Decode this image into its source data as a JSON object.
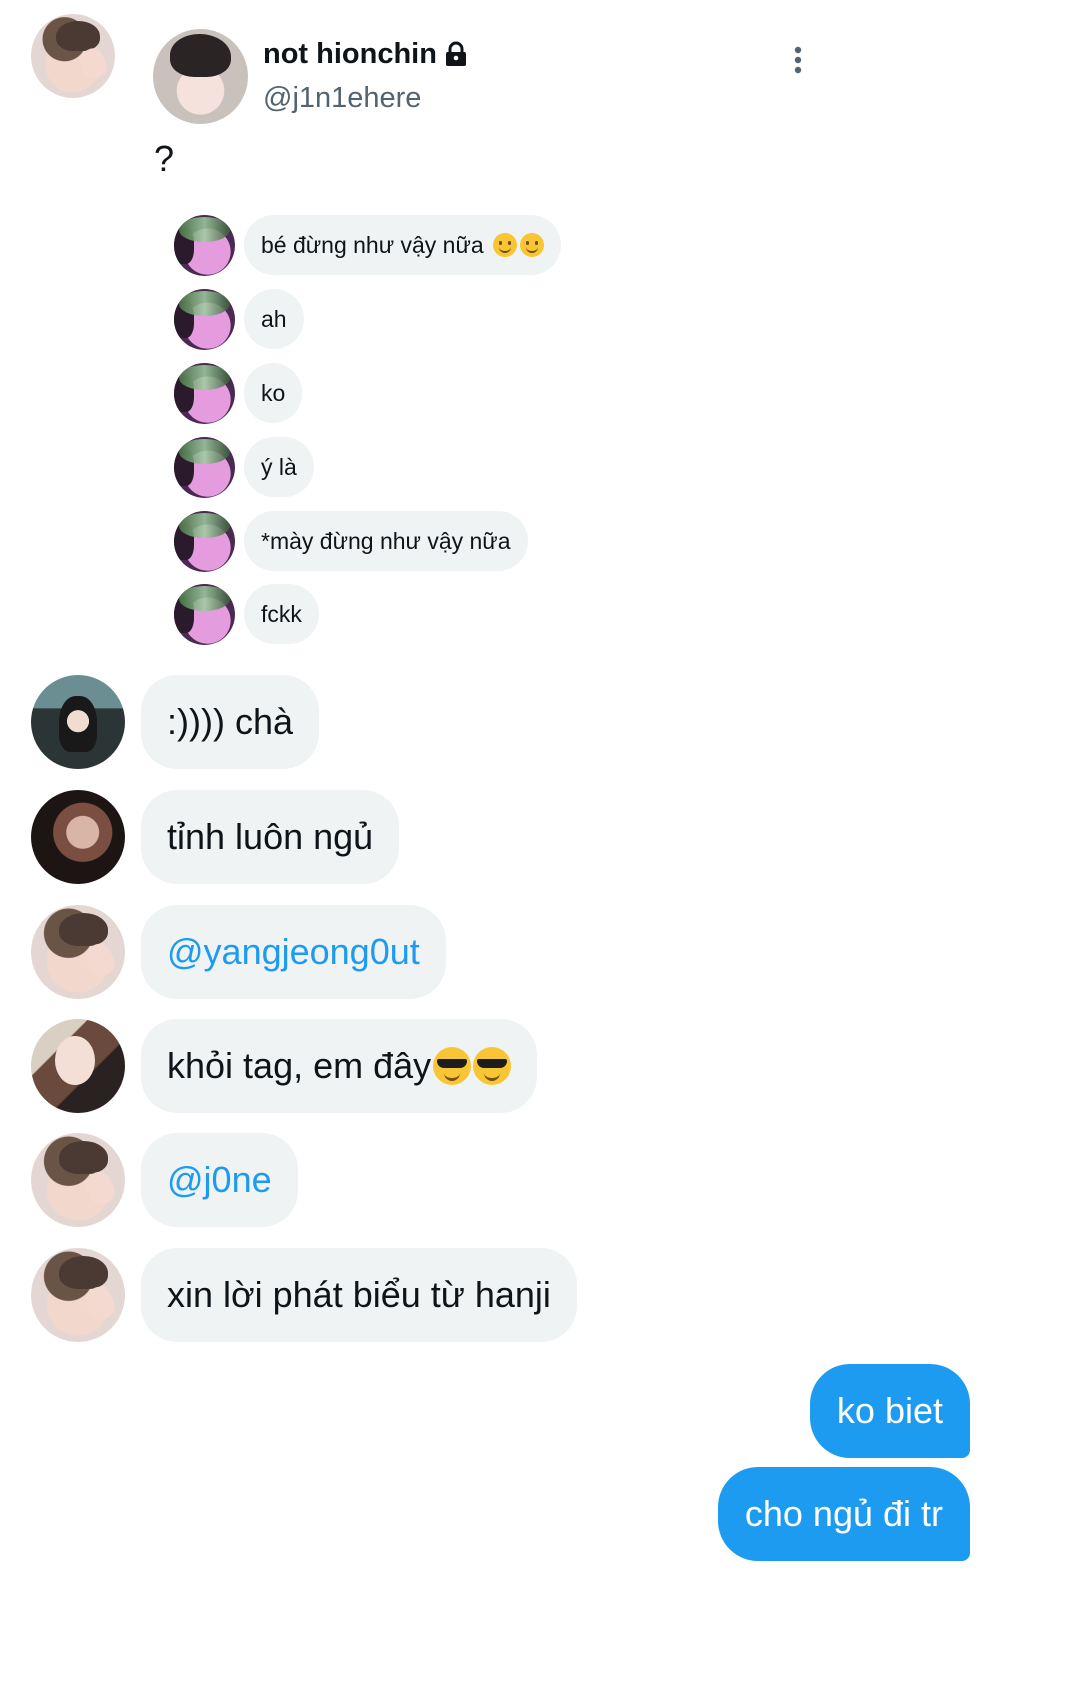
{
  "quoted_tweet": {
    "display_name": "not hionchin",
    "handle": "@j1n1ehere",
    "text": "?",
    "more_icon": "more-vertical-icon",
    "lock_icon": "lock-icon"
  },
  "quoted_messages": [
    {
      "text": "bé đừng như vậy nữa",
      "emoji": "slightly-smiling-face"
    },
    {
      "text": "ah"
    },
    {
      "text": "ko"
    },
    {
      "text": "ý là"
    },
    {
      "text": "*mày đừng như vậy nữa"
    },
    {
      "text": "fckk"
    }
  ],
  "messages": [
    {
      "text": ":)))) chà"
    },
    {
      "text": "tỉnh luôn ngủ"
    },
    {
      "text": "@yangjeong0ut",
      "is_mention": true
    },
    {
      "text": "khỏi tag, em đây",
      "emoji": "smiling-face-with-sunglasses"
    },
    {
      "text": "@j0ne",
      "is_mention": true
    },
    {
      "text": "xin lời phát biểu từ hanji"
    }
  ],
  "my_messages": [
    {
      "text": "ko biet"
    },
    {
      "text": "cho ngủ đi tr"
    }
  ],
  "colors": {
    "accent": "#1d9bf0",
    "bubble_bg": "#eff3f4",
    "text": "#0f1419",
    "secondary_text": "#536471"
  }
}
